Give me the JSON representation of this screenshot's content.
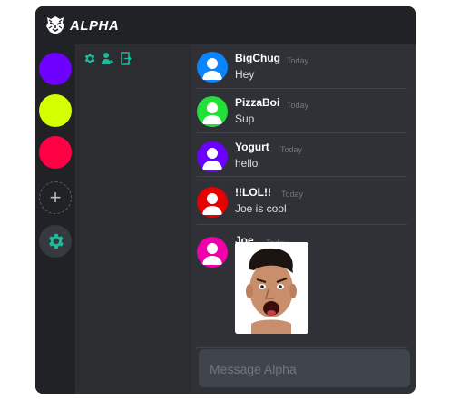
{
  "app": {
    "title": "ALPHA",
    "logo_icon": "tiger-head-icon"
  },
  "servers": [
    {
      "name": "server-purple",
      "color": "#6e00ff"
    },
    {
      "name": "server-lime",
      "color": "#d4ff00"
    },
    {
      "name": "server-red",
      "color": "#ff0044"
    }
  ],
  "server_actions": {
    "add_symbol": "+",
    "add_icon": "plus-icon",
    "settings_icon": "gear-icon",
    "settings_color": "#1abc9c"
  },
  "channel_tools": {
    "icons": [
      "gear-icon",
      "add-user-icon",
      "leave-door-icon"
    ],
    "color": "#1abc9c"
  },
  "messages": [
    {
      "author": "BigChug",
      "time": "Today",
      "text": "Hey",
      "avatar_color": "#0a84ff"
    },
    {
      "author": "PizzaBoi",
      "time": "Today",
      "text": "Sup",
      "avatar_color": "#22e03a"
    },
    {
      "author": "Yogurt",
      "time": "Today",
      "text": "hello",
      "avatar_color": "#6a00ff"
    },
    {
      "author": "!!LOL!!",
      "time": "Today",
      "text": "Joe is cool",
      "avatar_color": "#e60000"
    },
    {
      "author": "Joe",
      "time": "Today",
      "text": "",
      "avatar_color": "#ee00aa",
      "attachment": "surprised-face-image"
    }
  ],
  "composer": {
    "placeholder": "Message Alpha"
  }
}
